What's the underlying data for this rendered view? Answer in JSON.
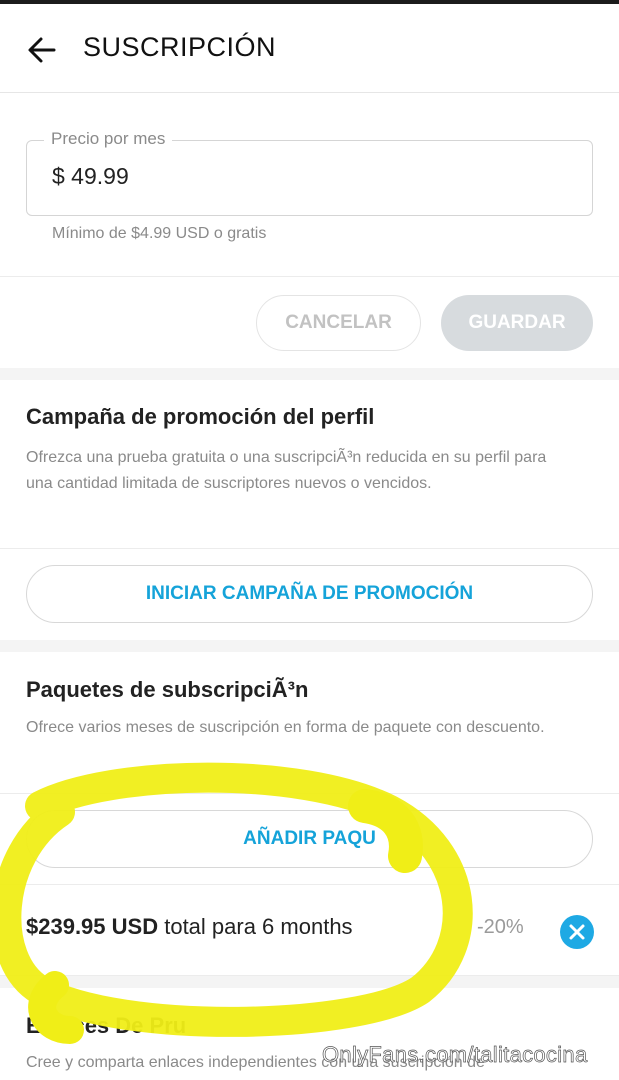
{
  "header": {
    "title": "SUSCRIPCIÓN"
  },
  "price": {
    "label": "Precio por mes",
    "value": "$ 49.99",
    "hint": "Mínimo de $4.99 USD o gratis"
  },
  "actions": {
    "cancel_label": "CANCELAR",
    "save_label": "GUARDAR"
  },
  "promo": {
    "title": "Campaña de promoción del perfil",
    "description": "Ofrezca una prueba gratuita o una suscripciÃ³n reducida en su perfil para una cantidad limitada de suscriptores nuevos o vencidos.",
    "button_label": "INICIAR CAMPAÑA DE PROMOCIÓN"
  },
  "bundles": {
    "title": "Paquetes de subscripciÃ³n",
    "description": "Ofrece varios meses de suscripción en forma de paquete con descuento.",
    "add_label": "AÑADIR PAQU",
    "item": {
      "price": "$239.95 USD",
      "text": "total para 6 months",
      "discount": "-20%"
    }
  },
  "links": {
    "title": "Enlaces De Pru",
    "description": "Cree y comparta enlaces independientes con una suscripción de"
  },
  "watermark": "OnlyFans.com/talitacocina",
  "colors": {
    "accent": "#15a3d9",
    "remove": "#1ea9e4",
    "highlight": "#f0ee17",
    "muted": "#8a8a8a"
  },
  "icons": {
    "back": "arrow-left-icon",
    "remove": "close-circle-icon"
  }
}
